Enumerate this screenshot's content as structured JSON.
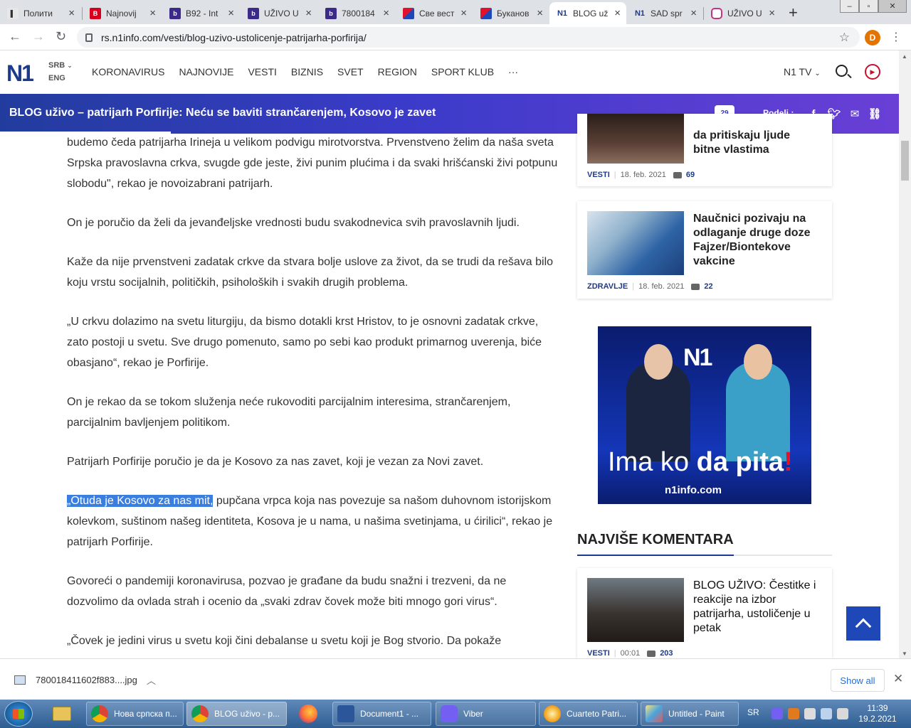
{
  "browser": {
    "tabs": [
      {
        "label": "Полити",
        "favicon": "serbian-flag"
      },
      {
        "label": "Najnovij",
        "favicon": "blic"
      },
      {
        "label": "B92 - Int",
        "favicon": "b92"
      },
      {
        "label": "UŽIVO U",
        "favicon": "b92"
      },
      {
        "label": "7800184",
        "favicon": "b92"
      },
      {
        "label": "Све вест",
        "favicon": "star"
      },
      {
        "label": "Буканов",
        "favicon": "star"
      },
      {
        "label": "BLOG už",
        "favicon": "n1"
      },
      {
        "label": "SAD spr",
        "favicon": "n1"
      },
      {
        "label": "UŽIVO U",
        "favicon": "instagram"
      }
    ],
    "active_tab_index": 7,
    "new_tab": "+",
    "url": "rs.n1info.com/vesti/blog-uzivo-ustolicenje-patrijarha-porfirija/",
    "profile_initial": "D"
  },
  "site": {
    "logo": "N1",
    "lang_primary": "SRB",
    "lang_secondary": "ENG",
    "nav": [
      "KORONAVIRUS",
      "NAJNOVIJE",
      "VESTI",
      "BIZNIS",
      "SVET",
      "REGION",
      "SPORT KLUB",
      "···"
    ],
    "tv_label": "N1 TV"
  },
  "banner": {
    "title": "BLOG uživo – patrijarh Porfirije: Neću se baviti strančarenjem, Kosovo je zavet",
    "comment_count": "29",
    "share_label": "Podeli :",
    "reading_progress": 0.19
  },
  "article": {
    "paragraphs": [
      "budemo čeda patrijarha Irineja u velikom podvigu mirotvorstva. Prvenstveno želim da naša sveta Srpska pravoslavna crkva, svugde gde jeste, živi punim plućima i da svaki hrišćanski živi potpunu slobodu\", rekao je novoizabrani patrijarh.",
      "On je poručio da želi da jevanđeljske vrednosti budu svakodnevica svih pravoslavnih ljudi.",
      "Kaže da nije prvenstveni zadatak crkve da stvara bolje uslove za život, da se trudi da rešava bilo koju vrstu socijalnih, političkih, psiholoških i svakih drugih problema.",
      "„U crkvu dolazimo na svetu liturgiju, da bismo dotakli krst Hristov, to je osnovni zadatak crkve, zato postoji u svetu. Sve drugo pomenuto, samo po sebi kao produkt primarnog uverenja, biće obasjano“, rekao je Porfirije.",
      "On je rekao da se tokom služenja neće rukovoditi parcijalnim interesima, strančarenjem, parcijalnim bavljenjem politikom.",
      "Patrijarh Porfirije poručio je da je Kosovo za nas zavet, koji je vezan za Novi zavet."
    ],
    "highlight_text": "„Otuda je Kosovo za nas mit,",
    "highlight_rest": " pupčana vrpca koja nas povezuje sa našom duhovnom istorijskom kolevkom, suštinom našeg identiteta, Kosova je u nama, u našima svetinjama, u ćirilici“, rekao je patrijarh Porfirije.",
    "paragraphs_after": [
      "Govoreći o pandemiji koronavirusa, pozvao je građane da budu snažni i trezveni, da ne dozvolimo da ovlada strah i ocenio da „svaki zdrav čovek može biti mnogo gori virus“.",
      "„Čovek je jedini virus u svetu koji čini debalanse u svetu koji je Bog stvorio. Da pokaže"
    ]
  },
  "sidebar": {
    "cards": [
      {
        "title_line1": "da pritiskaju ljude",
        "title_line2": "bitne vlastima",
        "category": "VESTI",
        "date": "18. feb. 2021",
        "comments": "69"
      },
      {
        "title": "Naučnici pozivaju na odlaganje druge doze Fajzer/Biontekove vakcine",
        "category": "ZDRAVLJE",
        "date": "18. feb. 2021",
        "comments": "22"
      }
    ],
    "ad": {
      "logo": "N1",
      "slogan_plain": "Ima ko ",
      "slogan_bold": "da pita",
      "slogan_mark": "!",
      "url": "n1info.com"
    },
    "most_commented_title": "NAJVIŠE KOMENTARA",
    "most_commented": [
      {
        "title": "BLOG UŽIVO: Čestitke i reakcije na izbor patrijarha, ustoličenje u petak",
        "category": "VESTI",
        "date": "00:01",
        "comments": "203"
      }
    ]
  },
  "download_bar": {
    "filename": "780018411602f883....jpg",
    "show_all": "Show all"
  },
  "taskbar": {
    "items": [
      {
        "label": "Нова српска п...",
        "icon": "chrome"
      },
      {
        "label": "BLOG uživo - p...",
        "icon": "chrome",
        "active": true
      },
      {
        "label": "Document1 - ...",
        "icon": "word"
      },
      {
        "label": "Viber",
        "icon": "viber"
      },
      {
        "label": "Cuarteto Patri...",
        "icon": "media"
      },
      {
        "label": "Untitled - Paint",
        "icon": "paint"
      }
    ],
    "language": "SR",
    "time": "11:39",
    "date": "19.2.2021"
  },
  "colors": {
    "brand": "#1e3a8a",
    "banner_start": "#223c9e",
    "banner_end": "#6a3fd6",
    "highlight": "#3a7fe0",
    "live_red": "#c8102e"
  }
}
